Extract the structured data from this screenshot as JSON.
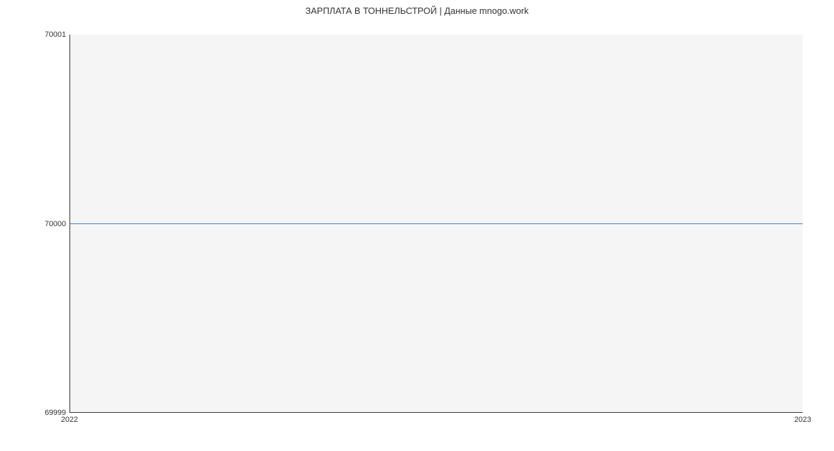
{
  "chart_data": {
    "type": "line",
    "title": "ЗАРПЛАТА В ТОННЕЛЬСТРОЙ | Данные mnogo.work",
    "x": [
      "2022",
      "2023"
    ],
    "values": [
      70000,
      70000
    ],
    "xlabel": "",
    "ylabel": "",
    "ylim": [
      69999,
      70001
    ],
    "y_ticks": [
      69999,
      70000,
      70001
    ],
    "x_ticks": [
      "2022",
      "2023"
    ],
    "series_color": "#4a7fc9"
  }
}
